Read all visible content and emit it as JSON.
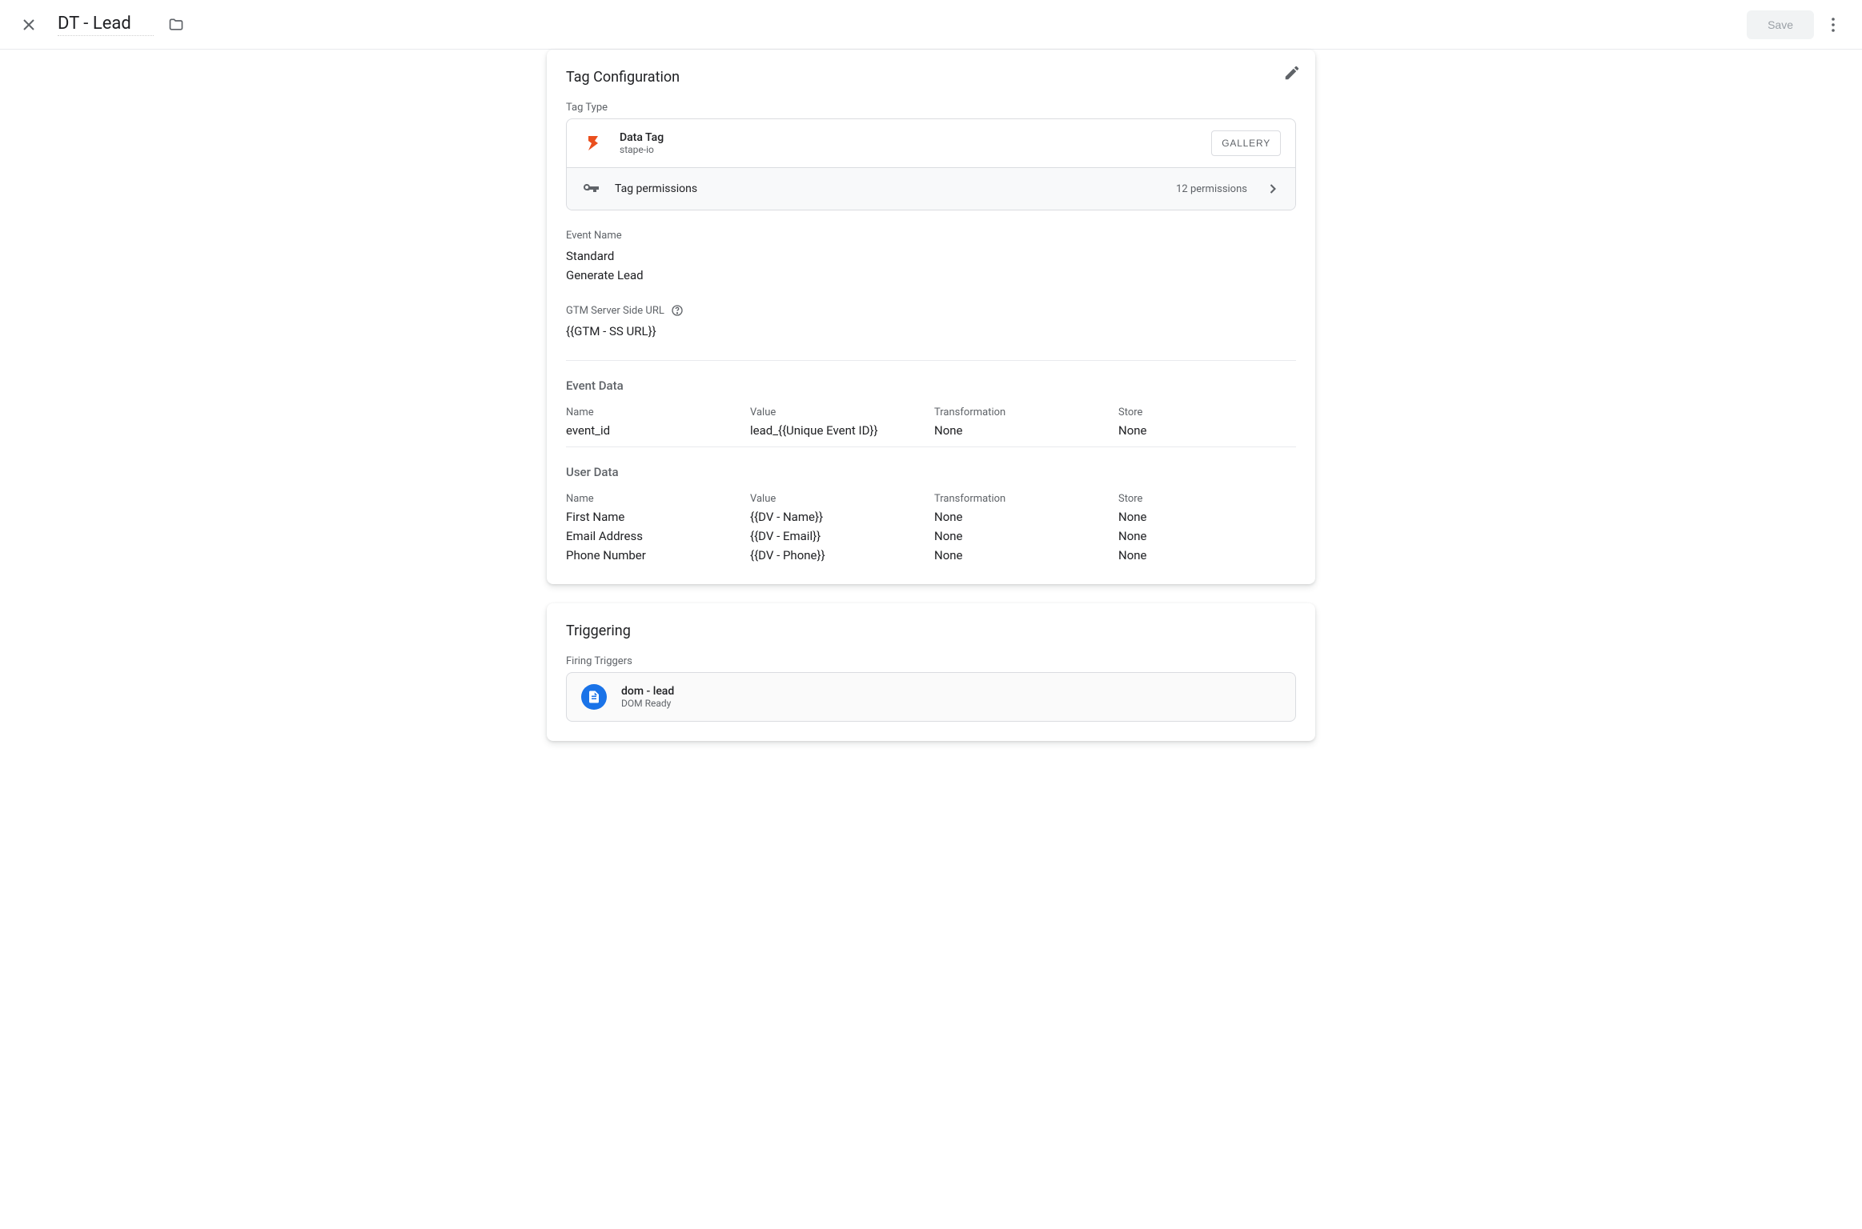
{
  "header": {
    "title": "DT - Lead",
    "save_label": "Save"
  },
  "tagConfig": {
    "title": "Tag Configuration",
    "tagTypeLabel": "Tag Type",
    "tag": {
      "name": "Data Tag",
      "vendor": "stape-io"
    },
    "galleryLabel": "GALLERY",
    "permissions": {
      "label": "Tag permissions",
      "count": "12 permissions"
    },
    "eventName": {
      "label": "Event Name",
      "values": [
        "Standard",
        "Generate Lead"
      ]
    },
    "ssUrl": {
      "label": "GTM Server Side URL",
      "value": "{{GTM - SS URL}}"
    },
    "eventData": {
      "title": "Event Data",
      "columns": [
        "Name",
        "Value",
        "Transformation",
        "Store"
      ],
      "rows": [
        {
          "name": "event_id",
          "value": "lead_{{Unique Event ID}}",
          "transformation": "None",
          "store": "None"
        }
      ]
    },
    "userData": {
      "title": "User Data",
      "columns": [
        "Name",
        "Value",
        "Transformation",
        "Store"
      ],
      "rows": [
        {
          "name": "First Name",
          "value": "{{DV - Name}}",
          "transformation": "None",
          "store": "None"
        },
        {
          "name": "Email Address",
          "value": "{{DV - Email}}",
          "transformation": "None",
          "store": "None"
        },
        {
          "name": "Phone Number",
          "value": "{{DV - Phone}}",
          "transformation": "None",
          "store": "None"
        }
      ]
    }
  },
  "triggering": {
    "title": "Triggering",
    "firingLabel": "Firing Triggers",
    "trigger": {
      "name": "dom - lead",
      "type": "DOM Ready"
    }
  }
}
